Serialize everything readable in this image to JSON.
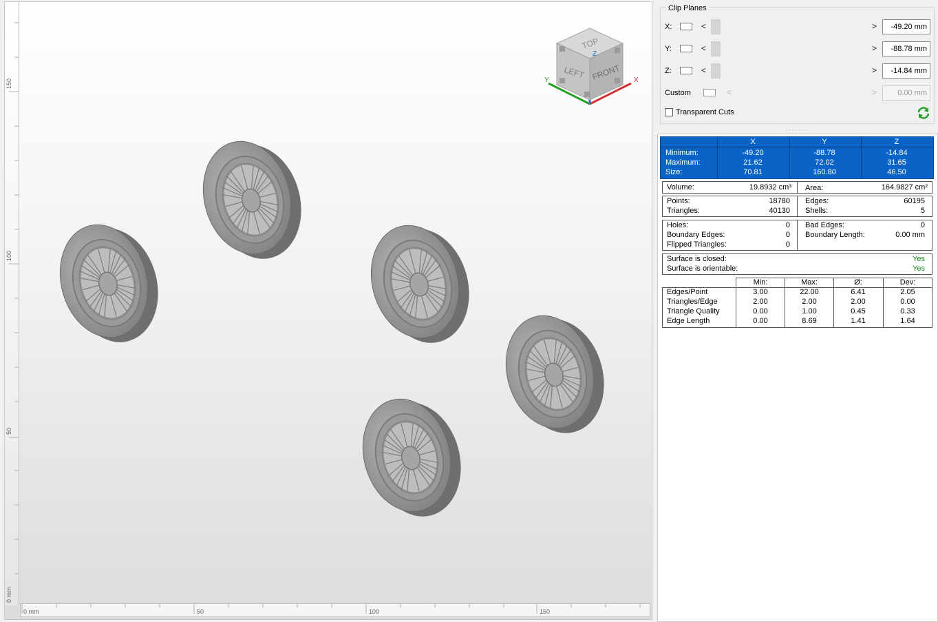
{
  "viewport": {
    "ruler_vertical": [
      "150",
      "100",
      "50",
      "0 mm"
    ],
    "ruler_horizontal": [
      "0 mm",
      "50",
      "100",
      "150"
    ],
    "view_cube": {
      "faces": [
        "TOP",
        "LEFT",
        "FRONT"
      ],
      "axes": [
        "Z",
        "Y",
        "X"
      ],
      "colors": {
        "x": "#d03030",
        "y": "#2aa02a",
        "z": "#1e6fd8"
      }
    },
    "objects": [
      "wire-wheel",
      "wire-wheel",
      "wire-wheel",
      "wire-wheel",
      "wire-wheel"
    ]
  },
  "clip_planes": {
    "title": "Clip Planes",
    "rows": [
      {
        "label": "X:",
        "value": "-49.20 mm",
        "enabled": true
      },
      {
        "label": "Y:",
        "value": "-88.78 mm",
        "enabled": true
      },
      {
        "label": "Z:",
        "value": "-14.84 mm",
        "enabled": true
      },
      {
        "label": "Custom",
        "value": "0.00 mm",
        "enabled": false
      }
    ],
    "arrow_left": "<",
    "arrow_right": ">",
    "transparent_cuts": "Transparent Cuts",
    "refresh_icon": "refresh-icon"
  },
  "bounding_box": {
    "headers": [
      "X",
      "Y",
      "Z"
    ],
    "rows": [
      {
        "label": "Minimum:",
        "values": [
          "-49.20",
          "-88.78",
          "-14.84"
        ]
      },
      {
        "label": "Maximum:",
        "values": [
          "21.62",
          "72.02",
          "31.65"
        ]
      },
      {
        "label": "Size:",
        "values": [
          "70.81",
          "160.80",
          "46.50"
        ]
      }
    ]
  },
  "measures": {
    "volume_label": "Volume:",
    "volume_value": "19.8932 cm³",
    "area_label": "Area:",
    "area_value": "164.9827 cm²"
  },
  "topology": {
    "points_label": "Points:",
    "points_value": "18780",
    "triangles_label": "Triangles:",
    "triangles_value": "40130",
    "edges_label": "Edges:",
    "edges_value": "60195",
    "shells_label": "Shells:",
    "shells_value": "5"
  },
  "errors": {
    "holes_label": "Holes:",
    "holes_value": "0",
    "boundary_edges_label": "Boundary Edges:",
    "boundary_edges_value": "0",
    "flipped_label": "Flipped Triangles:",
    "flipped_value": "0",
    "bad_edges_label": "Bad Edges:",
    "bad_edges_value": "0",
    "boundary_length_label": "Boundary Length:",
    "boundary_length_value": "0.00 mm"
  },
  "surface": {
    "closed_label": "Surface is closed:",
    "closed_value": "Yes",
    "orientable_label": "Surface is orientable:",
    "orientable_value": "Yes"
  },
  "statistics": {
    "headers": [
      "Min:",
      "Max:",
      "Ø:",
      "Dev:"
    ],
    "rows": [
      {
        "label": "Edges/Point",
        "values": [
          "3.00",
          "22.00",
          "6.41",
          "2.05"
        ]
      },
      {
        "label": "Triangles/Edge",
        "values": [
          "2.00",
          "2.00",
          "2.00",
          "0.00"
        ]
      },
      {
        "label": "Triangle Quality",
        "values": [
          "0.00",
          "1.00",
          "0.45",
          "0.33"
        ]
      },
      {
        "label": "Edge Length",
        "values": [
          "0.00",
          "8.69",
          "1.41",
          "1.64"
        ]
      }
    ]
  }
}
